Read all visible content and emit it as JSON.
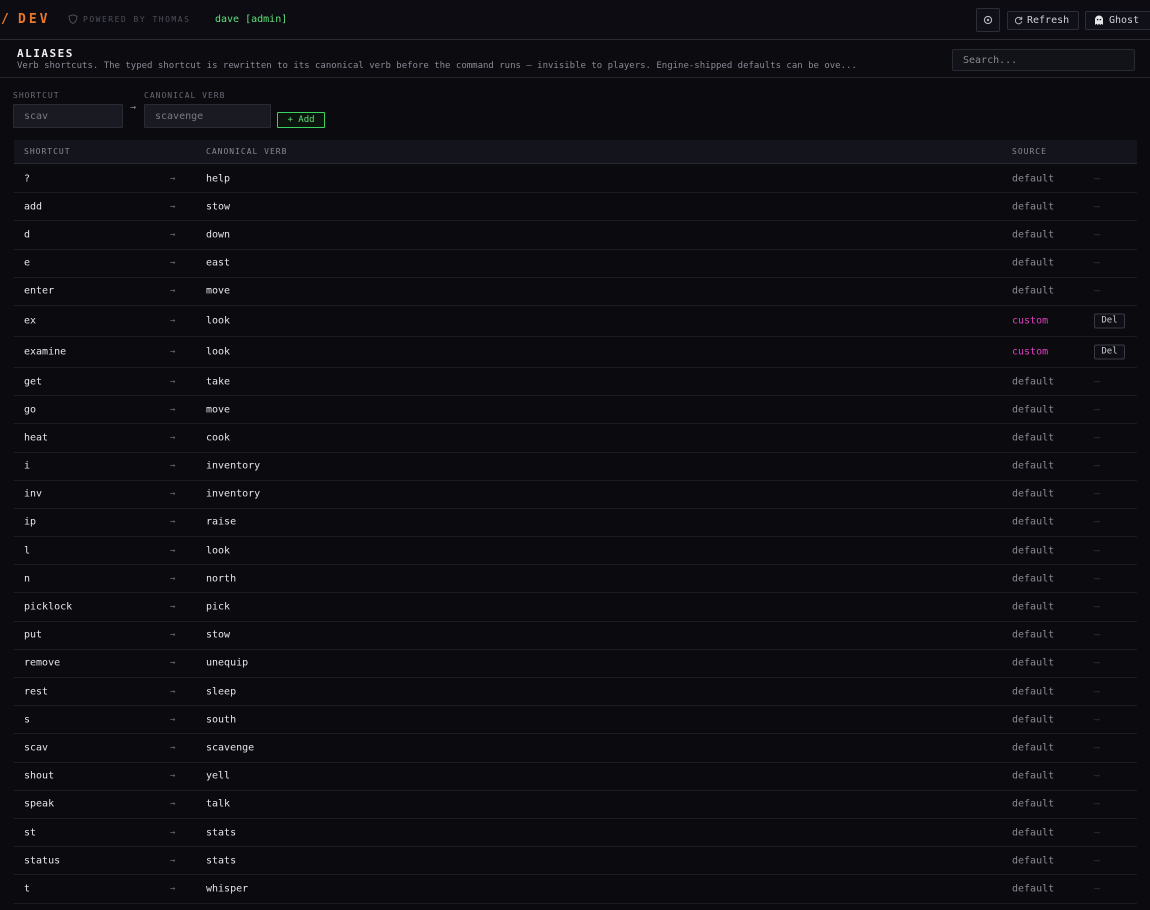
{
  "topbar": {
    "brand_mark": "/",
    "brand": "DEV",
    "powered": "POWERED BY THOMAS",
    "user": "dave [admin]",
    "refresh_label": "Refresh",
    "ghost_label": "Ghost"
  },
  "header": {
    "title": "ALIASES",
    "description": "Verb shortcuts. The typed shortcut is rewritten to its canonical verb before the command runs — invisible to players. Engine-shipped defaults can be ove...",
    "search_placeholder": "Search..."
  },
  "form": {
    "shortcut_label": "SHORTCUT",
    "shortcut_placeholder": "scav",
    "arrow": "→",
    "verb_label": "CANONICAL VERB",
    "verb_placeholder": "scavenge",
    "add_label": "+ Add"
  },
  "table": {
    "columns": {
      "shortcut": "SHORTCUT",
      "verb": "CANONICAL VERB",
      "source": "SOURCE"
    },
    "arrow": "→",
    "none": "—",
    "delete_label": "Del",
    "rows": [
      {
        "shortcut": "?",
        "verb": "help",
        "source": "default"
      },
      {
        "shortcut": "add",
        "verb": "stow",
        "source": "default"
      },
      {
        "shortcut": "d",
        "verb": "down",
        "source": "default"
      },
      {
        "shortcut": "e",
        "verb": "east",
        "source": "default"
      },
      {
        "shortcut": "enter",
        "verb": "move",
        "source": "default"
      },
      {
        "shortcut": "ex",
        "verb": "look",
        "source": "custom"
      },
      {
        "shortcut": "examine",
        "verb": "look",
        "source": "custom"
      },
      {
        "shortcut": "get",
        "verb": "take",
        "source": "default"
      },
      {
        "shortcut": "go",
        "verb": "move",
        "source": "default"
      },
      {
        "shortcut": "heat",
        "verb": "cook",
        "source": "default"
      },
      {
        "shortcut": "i",
        "verb": "inventory",
        "source": "default"
      },
      {
        "shortcut": "inv",
        "verb": "inventory",
        "source": "default"
      },
      {
        "shortcut": "ip",
        "verb": "raise",
        "source": "default"
      },
      {
        "shortcut": "l",
        "verb": "look",
        "source": "default"
      },
      {
        "shortcut": "n",
        "verb": "north",
        "source": "default"
      },
      {
        "shortcut": "picklock",
        "verb": "pick",
        "source": "default"
      },
      {
        "shortcut": "put",
        "verb": "stow",
        "source": "default"
      },
      {
        "shortcut": "remove",
        "verb": "unequip",
        "source": "default"
      },
      {
        "shortcut": "rest",
        "verb": "sleep",
        "source": "default"
      },
      {
        "shortcut": "s",
        "verb": "south",
        "source": "default"
      },
      {
        "shortcut": "scav",
        "verb": "scavenge",
        "source": "default"
      },
      {
        "shortcut": "shout",
        "verb": "yell",
        "source": "default"
      },
      {
        "shortcut": "speak",
        "verb": "talk",
        "source": "default"
      },
      {
        "shortcut": "st",
        "verb": "stats",
        "source": "default"
      },
      {
        "shortcut": "status",
        "verb": "stats",
        "source": "default"
      },
      {
        "shortcut": "t",
        "verb": "whisper",
        "source": "default"
      }
    ]
  },
  "colors": {
    "accent": "#e8782a",
    "user": "#5fe07a",
    "custom_source": "#e040c0",
    "background": "#0a0a0f"
  },
  "icons": [
    "shield-icon",
    "gear-icon",
    "refresh-icon",
    "ghost-icon"
  ]
}
